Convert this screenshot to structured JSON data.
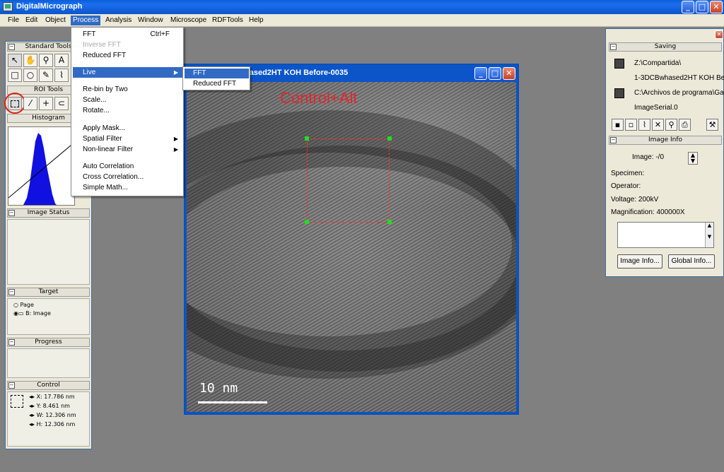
{
  "app": {
    "title": "DigitalMicrograph"
  },
  "menubar": [
    {
      "label": "File"
    },
    {
      "label": "Edit"
    },
    {
      "label": "Object"
    },
    {
      "label": "Process"
    },
    {
      "label": "Analysis"
    },
    {
      "label": "Window"
    },
    {
      "label": "Microscope"
    },
    {
      "label": "RDFTools"
    },
    {
      "label": "Help"
    }
  ],
  "process_menu": {
    "fft": "FFT",
    "fft_shortcut": "Ctrl+F",
    "inverse_fft": "Inverse FFT",
    "reduced_fft": "Reduced FFT",
    "live": "Live",
    "rebin": "Re-bin by Two",
    "scale": "Scale...",
    "rotate": "Rotate...",
    "apply_mask": "Apply Mask...",
    "spatial_filter": "Spatial Filter",
    "nonlinear_filter": "Non-linear Filter",
    "auto_corr": "Auto Correlation",
    "cross_corr": "Cross Correlation...",
    "simple_math": "Simple Math..."
  },
  "live_submenu": {
    "fft": "FFT",
    "reduced_fft": "Reduced FFT"
  },
  "left_palette": {
    "standard_tools": "Standard Tools",
    "roi_tools": "ROI Tools",
    "histogram": "Histogram",
    "image_status": "Image Status",
    "target": "Target",
    "target_page": "Page",
    "target_image": "B: Image",
    "progress": "Progress",
    "control": "Control",
    "x": "X: 17.786 nm",
    "y": "Y: 8.461 nm",
    "w": "W: 12.306 nm",
    "h": "H: 12.306 nm"
  },
  "image_window": {
    "title": "hased2HT KOH Before-0035",
    "annotation": "Control+Alt",
    "scale_label": "10 nm"
  },
  "saving": {
    "header": "Saving",
    "path1a": "Z:\\Compartida\\",
    "path1b": "1-3DCBwhased2HT KOH Be",
    "path2a": "C:\\Archivos de programa\\Ga",
    "path2b": "ImageSerial.0"
  },
  "image_info": {
    "header": "Image Info",
    "image": "Image: -/0",
    "specimen": "Specimen:",
    "operator": "Operator:",
    "voltage": "Voltage: 200kV",
    "magnification": "Magnification: 400000X",
    "btn_image_info": "Image Info...",
    "btn_global_info": "Global Info..."
  },
  "colors": {
    "accent": "#316ac5",
    "annotation": "#e8232a",
    "roi_handle": "#22dd22",
    "histogram": "#1010e0"
  }
}
